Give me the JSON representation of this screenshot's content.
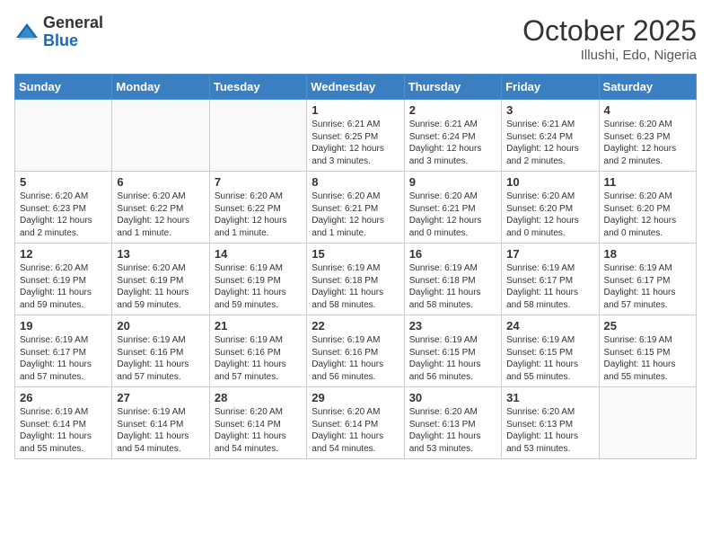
{
  "header": {
    "logo_general": "General",
    "logo_blue": "Blue",
    "month_title": "October 2025",
    "location": "Illushi, Edo, Nigeria"
  },
  "weekdays": [
    "Sunday",
    "Monday",
    "Tuesday",
    "Wednesday",
    "Thursday",
    "Friday",
    "Saturday"
  ],
  "weeks": [
    [
      {
        "day": "",
        "info": ""
      },
      {
        "day": "",
        "info": ""
      },
      {
        "day": "",
        "info": ""
      },
      {
        "day": "1",
        "info": "Sunrise: 6:21 AM\nSunset: 6:25 PM\nDaylight: 12 hours and 3 minutes."
      },
      {
        "day": "2",
        "info": "Sunrise: 6:21 AM\nSunset: 6:24 PM\nDaylight: 12 hours and 3 minutes."
      },
      {
        "day": "3",
        "info": "Sunrise: 6:21 AM\nSunset: 6:24 PM\nDaylight: 12 hours and 2 minutes."
      },
      {
        "day": "4",
        "info": "Sunrise: 6:20 AM\nSunset: 6:23 PM\nDaylight: 12 hours and 2 minutes."
      }
    ],
    [
      {
        "day": "5",
        "info": "Sunrise: 6:20 AM\nSunset: 6:23 PM\nDaylight: 12 hours and 2 minutes."
      },
      {
        "day": "6",
        "info": "Sunrise: 6:20 AM\nSunset: 6:22 PM\nDaylight: 12 hours and 1 minute."
      },
      {
        "day": "7",
        "info": "Sunrise: 6:20 AM\nSunset: 6:22 PM\nDaylight: 12 hours and 1 minute."
      },
      {
        "day": "8",
        "info": "Sunrise: 6:20 AM\nSunset: 6:21 PM\nDaylight: 12 hours and 1 minute."
      },
      {
        "day": "9",
        "info": "Sunrise: 6:20 AM\nSunset: 6:21 PM\nDaylight: 12 hours and 0 minutes."
      },
      {
        "day": "10",
        "info": "Sunrise: 6:20 AM\nSunset: 6:20 PM\nDaylight: 12 hours and 0 minutes."
      },
      {
        "day": "11",
        "info": "Sunrise: 6:20 AM\nSunset: 6:20 PM\nDaylight: 12 hours and 0 minutes."
      }
    ],
    [
      {
        "day": "12",
        "info": "Sunrise: 6:20 AM\nSunset: 6:19 PM\nDaylight: 11 hours and 59 minutes."
      },
      {
        "day": "13",
        "info": "Sunrise: 6:20 AM\nSunset: 6:19 PM\nDaylight: 11 hours and 59 minutes."
      },
      {
        "day": "14",
        "info": "Sunrise: 6:19 AM\nSunset: 6:19 PM\nDaylight: 11 hours and 59 minutes."
      },
      {
        "day": "15",
        "info": "Sunrise: 6:19 AM\nSunset: 6:18 PM\nDaylight: 11 hours and 58 minutes."
      },
      {
        "day": "16",
        "info": "Sunrise: 6:19 AM\nSunset: 6:18 PM\nDaylight: 11 hours and 58 minutes."
      },
      {
        "day": "17",
        "info": "Sunrise: 6:19 AM\nSunset: 6:17 PM\nDaylight: 11 hours and 58 minutes."
      },
      {
        "day": "18",
        "info": "Sunrise: 6:19 AM\nSunset: 6:17 PM\nDaylight: 11 hours and 57 minutes."
      }
    ],
    [
      {
        "day": "19",
        "info": "Sunrise: 6:19 AM\nSunset: 6:17 PM\nDaylight: 11 hours and 57 minutes."
      },
      {
        "day": "20",
        "info": "Sunrise: 6:19 AM\nSunset: 6:16 PM\nDaylight: 11 hours and 57 minutes."
      },
      {
        "day": "21",
        "info": "Sunrise: 6:19 AM\nSunset: 6:16 PM\nDaylight: 11 hours and 57 minutes."
      },
      {
        "day": "22",
        "info": "Sunrise: 6:19 AM\nSunset: 6:16 PM\nDaylight: 11 hours and 56 minutes."
      },
      {
        "day": "23",
        "info": "Sunrise: 6:19 AM\nSunset: 6:15 PM\nDaylight: 11 hours and 56 minutes."
      },
      {
        "day": "24",
        "info": "Sunrise: 6:19 AM\nSunset: 6:15 PM\nDaylight: 11 hours and 55 minutes."
      },
      {
        "day": "25",
        "info": "Sunrise: 6:19 AM\nSunset: 6:15 PM\nDaylight: 11 hours and 55 minutes."
      }
    ],
    [
      {
        "day": "26",
        "info": "Sunrise: 6:19 AM\nSunset: 6:14 PM\nDaylight: 11 hours and 55 minutes."
      },
      {
        "day": "27",
        "info": "Sunrise: 6:19 AM\nSunset: 6:14 PM\nDaylight: 11 hours and 54 minutes."
      },
      {
        "day": "28",
        "info": "Sunrise: 6:20 AM\nSunset: 6:14 PM\nDaylight: 11 hours and 54 minutes."
      },
      {
        "day": "29",
        "info": "Sunrise: 6:20 AM\nSunset: 6:14 PM\nDaylight: 11 hours and 54 minutes."
      },
      {
        "day": "30",
        "info": "Sunrise: 6:20 AM\nSunset: 6:13 PM\nDaylight: 11 hours and 53 minutes."
      },
      {
        "day": "31",
        "info": "Sunrise: 6:20 AM\nSunset: 6:13 PM\nDaylight: 11 hours and 53 minutes."
      },
      {
        "day": "",
        "info": ""
      }
    ]
  ]
}
